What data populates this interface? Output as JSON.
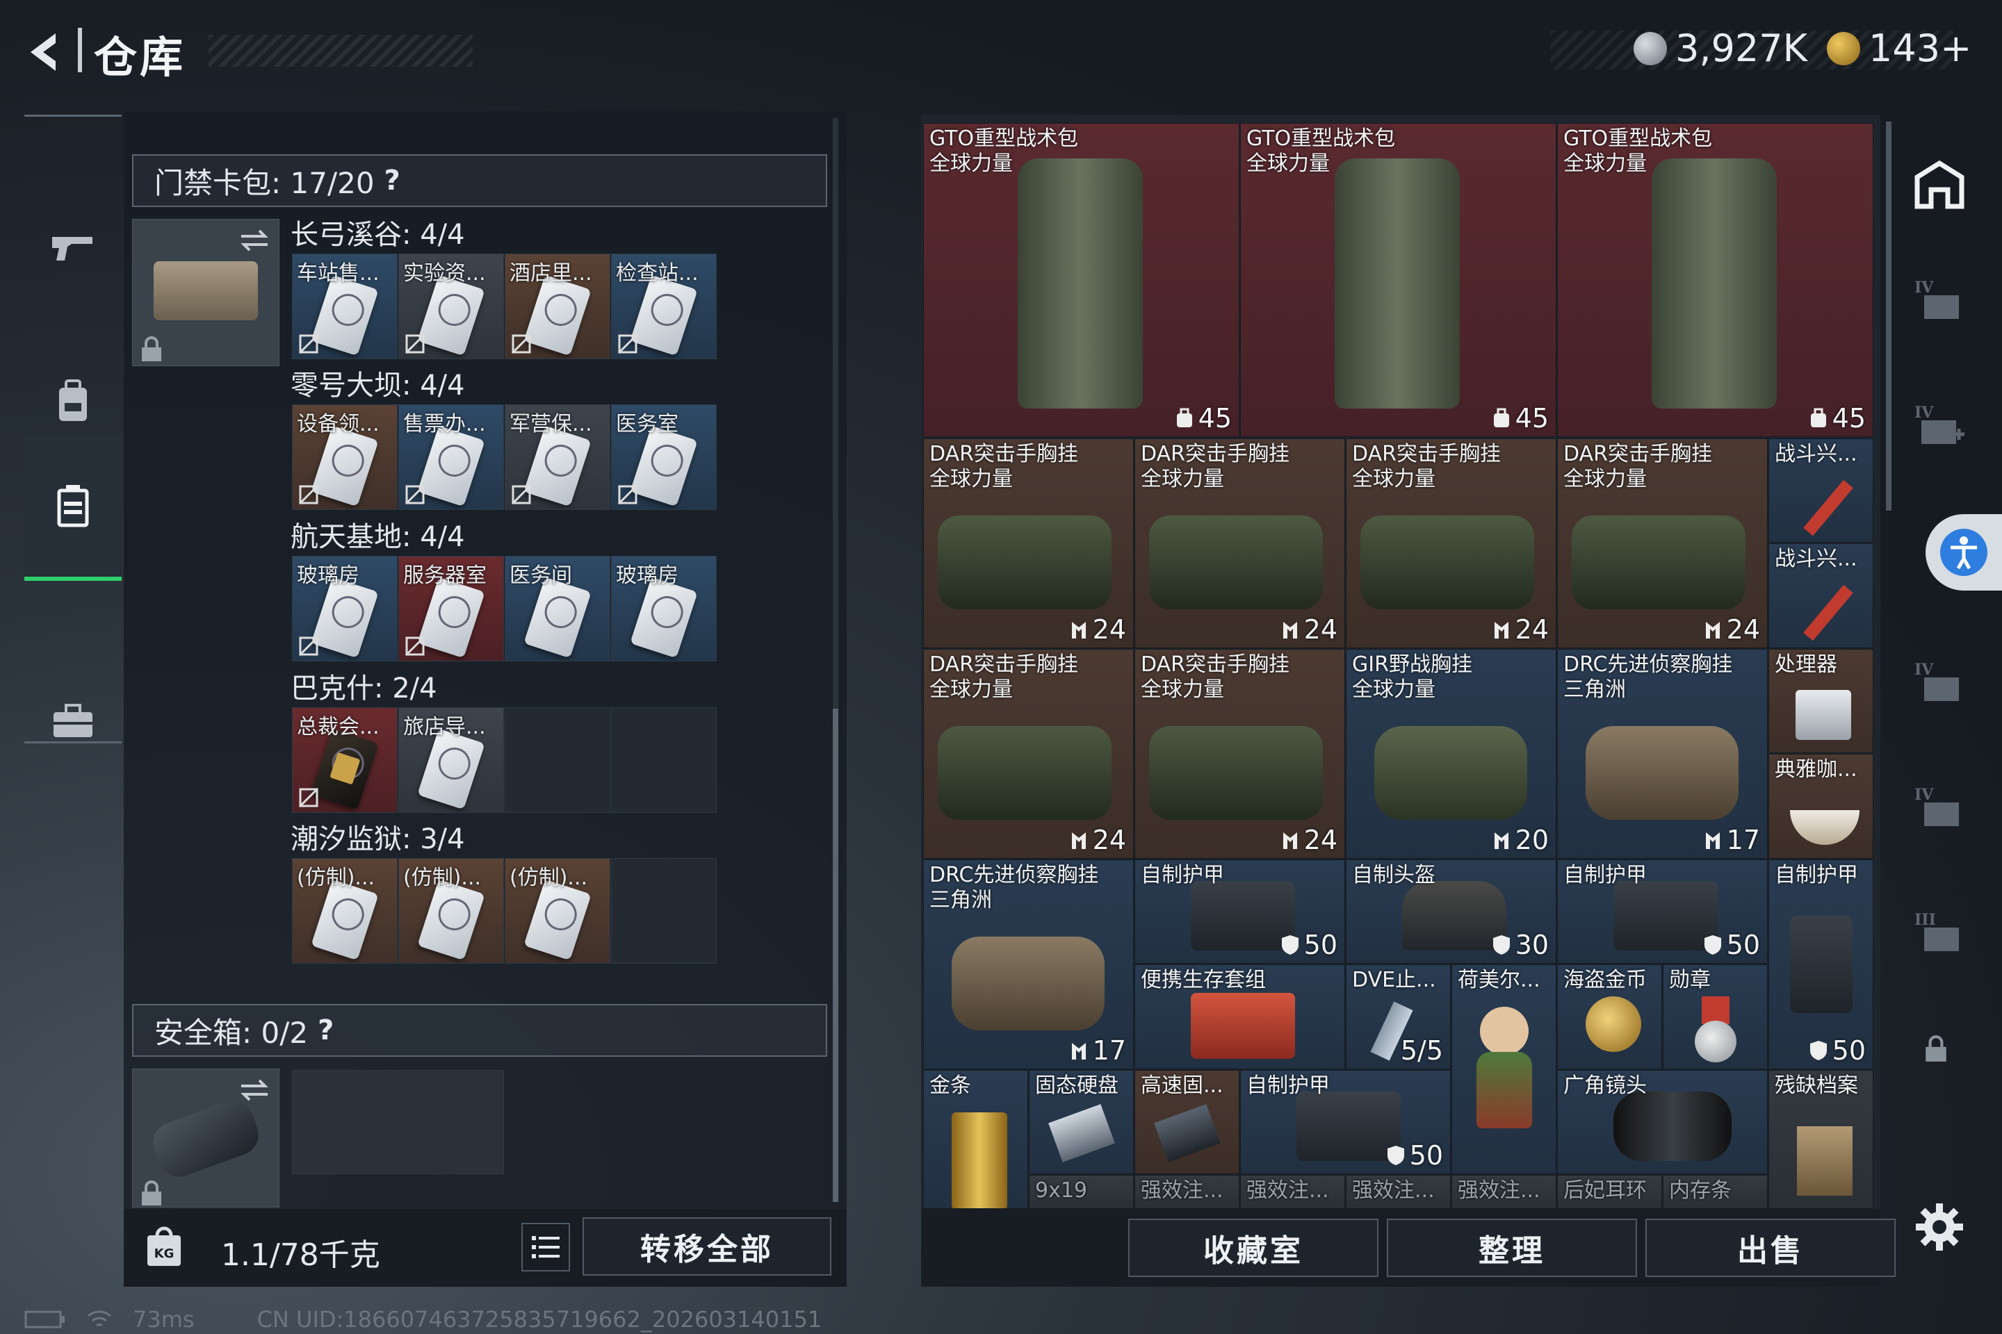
{
  "header": {
    "title": "仓库",
    "currency1": "3,927K",
    "currency2": "143+"
  },
  "left": {
    "keycard": {
      "title": "门禁卡包: 17/20",
      "qmark": "?"
    },
    "sections": [
      {
        "title": "长弓溪谷: 4/4",
        "slots": [
          {
            "label": "车站售..."
          },
          {
            "label": "实验资..."
          },
          {
            "label": "酒店里..."
          },
          {
            "label": "检查站..."
          }
        ]
      },
      {
        "title": "零号大坝: 4/4",
        "slots": [
          {
            "label": "设备领..."
          },
          {
            "label": "售票办..."
          },
          {
            "label": "军营保..."
          },
          {
            "label": "医务室"
          }
        ]
      },
      {
        "title": "航天基地: 4/4",
        "slots": [
          {
            "label": "玻璃房"
          },
          {
            "label": "服务器室"
          },
          {
            "label": "医务间"
          },
          {
            "label": "玻璃房"
          }
        ]
      },
      {
        "title": "巴克什: 2/4",
        "slots": [
          {
            "label": "总裁会..."
          },
          {
            "label": "旅店导..."
          }
        ]
      },
      {
        "title": "潮汐监狱: 3/4",
        "slots": [
          {
            "label": "(仿制)..."
          },
          {
            "label": "(仿制)..."
          },
          {
            "label": "(仿制)..."
          }
        ]
      }
    ],
    "safebox": {
      "title": "安全箱: 0/2",
      "qmark": "?"
    },
    "weight": "1.1/78千克",
    "transfer_all": "转移全部"
  },
  "grid": {
    "backpacks": [
      {
        "name": "GTO重型战术包\n全球力量",
        "count": "45"
      },
      {
        "name": "GTO重型战术包\n全球力量",
        "count": "45"
      },
      {
        "name": "GTO重型战术包\n全球力量",
        "count": "45"
      }
    ],
    "row2": [
      {
        "name": "DAR突击手胸挂\n全球力量",
        "count": "24"
      },
      {
        "name": "DAR突击手胸挂\n全球力量",
        "count": "24"
      },
      {
        "name": "DAR突击手胸挂\n全球力量",
        "count": "24"
      },
      {
        "name": "DAR突击手胸挂\n全球力量",
        "count": "24"
      }
    ],
    "flare1": "战斗兴...",
    "flare2": "战斗兴...",
    "row3": [
      {
        "name": "DAR突击手胸挂\n全球力量",
        "count": "24"
      },
      {
        "name": "DAR突击手胸挂\n全球力量",
        "count": "24"
      },
      {
        "name": "GIR野战胸挂\n全球力量",
        "count": "20"
      },
      {
        "name": "DRC先进侦察胸挂\n三角洲",
        "count": "17"
      }
    ],
    "processor": "处理器",
    "coffee": "典雅咖...",
    "drc": {
      "name": "DRC先进侦察胸挂\n三角洲",
      "count": "17"
    },
    "armor1": {
      "name": "自制护甲",
      "count": "50"
    },
    "helmet": {
      "name": "自制头盔",
      "count": "30"
    },
    "armor2": {
      "name": "自制护甲",
      "count": "50"
    },
    "armor3": {
      "name": "自制护甲",
      "count": "50"
    },
    "survival": "便携生存套组",
    "dve": {
      "name": "DVE止...",
      "count": "5/5"
    },
    "hummel": "荷美尔...",
    "pirate": "海盗金币",
    "medal": "勋章",
    "gold": "金条",
    "ssd": "固态硬盘",
    "fastssd": "高速固...",
    "armor4": {
      "name": "自制护甲",
      "count": "50"
    },
    "lens": "广角镜头",
    "archive": "残缺档案",
    "bottom_row": [
      "9x19",
      "强效注...",
      "强效注...",
      "强效注...",
      "强效注...",
      "后妃耳环",
      "内存条"
    ]
  },
  "buttons": {
    "collection": "收藏室",
    "organize": "整理",
    "sell": "出售"
  },
  "status": {
    "ping": "73ms",
    "uid": "CN UID:18660746372583571966​2_202603140151"
  }
}
